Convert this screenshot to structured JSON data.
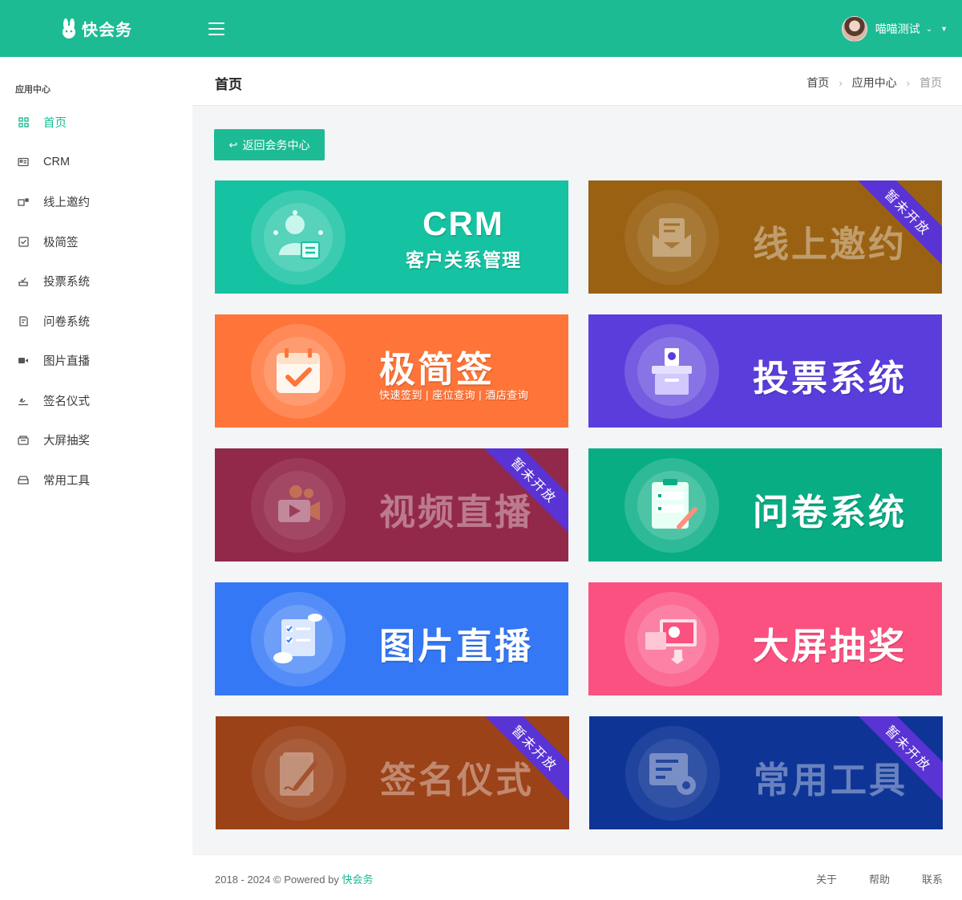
{
  "app": {
    "name": "快会务"
  },
  "header": {
    "user_name": "喵喵测试"
  },
  "sidebar": {
    "heading": "应用中心",
    "items": [
      {
        "label": "首页",
        "icon": "dashboard-icon",
        "active": true
      },
      {
        "label": "CRM",
        "icon": "contact-card-icon"
      },
      {
        "label": "线上邀约",
        "icon": "invite-icon"
      },
      {
        "label": "极简签",
        "icon": "checkin-icon"
      },
      {
        "label": "投票系统",
        "icon": "vote-icon"
      },
      {
        "label": "问卷系统",
        "icon": "survey-icon"
      },
      {
        "label": "图片直播",
        "icon": "camera-icon"
      },
      {
        "label": "签名仪式",
        "icon": "signature-icon"
      },
      {
        "label": "大屏抽奖",
        "icon": "lottery-icon"
      },
      {
        "label": "常用工具",
        "icon": "toolbox-icon"
      }
    ]
  },
  "page": {
    "title": "首页",
    "breadcrumb": [
      "首页",
      "应用中心",
      "首页"
    ],
    "back_button": "返回会务中心"
  },
  "cards": [
    {
      "title": "CRM",
      "subtitle": "客户关系管理",
      "color": "#15c2a1",
      "icon": "crm-user-icon",
      "disabled": false
    },
    {
      "title": "线上邀约",
      "color": "#9a6112",
      "icon": "envelope-icon",
      "disabled": true,
      "ribbon": "暂未开放"
    },
    {
      "title": "极简签",
      "subtitle": "快速签到 | 座位查询 | 酒店查询",
      "color": "#ff7438",
      "icon": "calendar-check-icon",
      "disabled": false
    },
    {
      "title": "投票系统",
      "color": "#5b3ddc",
      "icon": "ballot-box-icon",
      "disabled": false
    },
    {
      "title": "视频直播",
      "color": "#93294a",
      "icon": "video-camera-icon",
      "disabled": true,
      "ribbon": "暂未开放"
    },
    {
      "title": "问卷系统",
      "color": "#08ad84",
      "icon": "clipboard-form-icon",
      "disabled": false
    },
    {
      "title": "图片直播",
      "color": "#3478f6",
      "icon": "photo-list-icon",
      "disabled": false
    },
    {
      "title": "大屏抽奖",
      "color": "#fb5180",
      "icon": "big-screen-icon",
      "disabled": false
    },
    {
      "title": "签名仪式",
      "color": "#9b4218",
      "icon": "pen-paper-icon",
      "disabled": true,
      "ribbon": "暂未开放"
    },
    {
      "title": "常用工具",
      "color": "#0e3596",
      "icon": "tool-gear-icon",
      "disabled": true,
      "ribbon": "暂未开放"
    }
  ],
  "footer": {
    "copyright_prefix": "2018 - 2024 © Powered by ",
    "copyright_brand": "快会务",
    "links": [
      "关于",
      "帮助",
      "联系"
    ]
  }
}
